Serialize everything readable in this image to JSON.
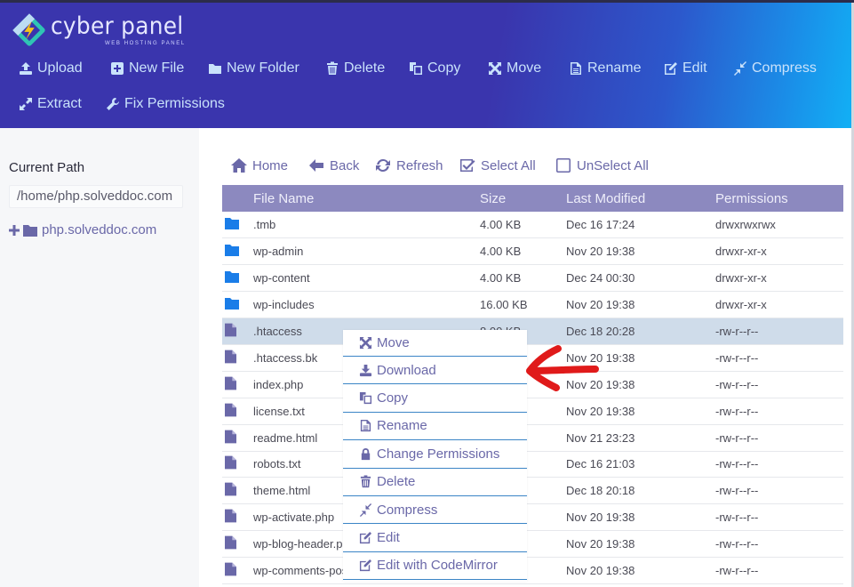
{
  "brand": {
    "title": "cyber panel",
    "subtitle": "WEB HOSTING PANEL"
  },
  "toolbar": {
    "upload": "Upload",
    "new_file": "New File",
    "new_folder": "New Folder",
    "delete": "Delete",
    "copy": "Copy",
    "move": "Move",
    "rename": "Rename",
    "edit": "Edit",
    "compress": "Compress",
    "extract": "Extract",
    "fix_permissions": "Fix Permissions"
  },
  "sidebar": {
    "current_path_label": "Current Path",
    "current_path_value": "/home/php.solveddoc.com",
    "tree_root": "php.solveddoc.com"
  },
  "nav": {
    "home": "Home",
    "back": "Back",
    "refresh": "Refresh",
    "select_all": "Select All",
    "unselect_all": "UnSelect All"
  },
  "table": {
    "headers": [
      "File Name",
      "Size",
      "Last Modified",
      "Permissions"
    ],
    "rows": [
      {
        "type": "folder",
        "name": ".tmb",
        "size": "4.00 KB",
        "modified": "Dec 16 17:24",
        "perms": "drwxrwxrwx"
      },
      {
        "type": "folder",
        "name": "wp-admin",
        "size": "4.00 KB",
        "modified": "Nov 20 19:38",
        "perms": "drwxr-xr-x"
      },
      {
        "type": "folder",
        "name": "wp-content",
        "size": "4.00 KB",
        "modified": "Dec 24 00:30",
        "perms": "drwxr-xr-x"
      },
      {
        "type": "folder",
        "name": "wp-includes",
        "size": "16.00 KB",
        "modified": "Nov 20 19:38",
        "perms": "drwxr-xr-x"
      },
      {
        "type": "file",
        "name": ".htaccess",
        "size": "8.00 KB",
        "modified": "Dec 18 20:28",
        "perms": "-rw-r--r--",
        "selected": true
      },
      {
        "type": "file",
        "name": ".htaccess.bk",
        "size": "",
        "modified": "Nov 20 19:38",
        "perms": "-rw-r--r--"
      },
      {
        "type": "file",
        "name": "index.php",
        "size": "",
        "modified": "Nov 20 19:38",
        "perms": "-rw-r--r--"
      },
      {
        "type": "file",
        "name": "license.txt",
        "size": "",
        "modified": "Nov 20 19:38",
        "perms": "-rw-r--r--"
      },
      {
        "type": "file",
        "name": "readme.html",
        "size": "",
        "modified": "Nov 21 23:23",
        "perms": "-rw-r--r--"
      },
      {
        "type": "file",
        "name": "robots.txt",
        "size": "",
        "modified": "Dec 16 21:03",
        "perms": "-rw-r--r--"
      },
      {
        "type": "file",
        "name": "theme.html",
        "size": "",
        "modified": "Dec 18 20:18",
        "perms": "-rw-r--r--"
      },
      {
        "type": "file",
        "name": "wp-activate.php",
        "size": "",
        "modified": "Nov 20 19:38",
        "perms": "-rw-r--r--"
      },
      {
        "type": "file",
        "name": "wp-blog-header.php",
        "size": "",
        "modified": "Nov 20 19:38",
        "perms": "-rw-r--r--"
      },
      {
        "type": "file",
        "name": "wp-comments-post.php",
        "size": "",
        "modified": "Nov 20 19:38",
        "perms": "-rw-r--r--"
      }
    ]
  },
  "context_menu": {
    "items": [
      {
        "label": "Move",
        "icon": "move-icon"
      },
      {
        "label": "Download",
        "icon": "download-icon"
      },
      {
        "label": "Copy",
        "icon": "copy-icon"
      },
      {
        "label": "Rename",
        "icon": "file-text-icon"
      },
      {
        "label": "Change Permissions",
        "icon": "lock-icon"
      },
      {
        "label": "Delete",
        "icon": "trash-icon"
      },
      {
        "label": "Compress",
        "icon": "compress-icon"
      },
      {
        "label": "Edit",
        "icon": "edit-icon"
      },
      {
        "label": "Edit with CodeMirror",
        "icon": "edit-icon"
      }
    ]
  },
  "colors": {
    "header_start": "#3a35ad",
    "header_end": "#12b0f5",
    "accent": "#6a68a8",
    "table_header": "#8c89bf",
    "selected_row": "#cfdcea",
    "folder_icon": "#1a7de8",
    "annotation_arrow": "#e01a1a"
  }
}
